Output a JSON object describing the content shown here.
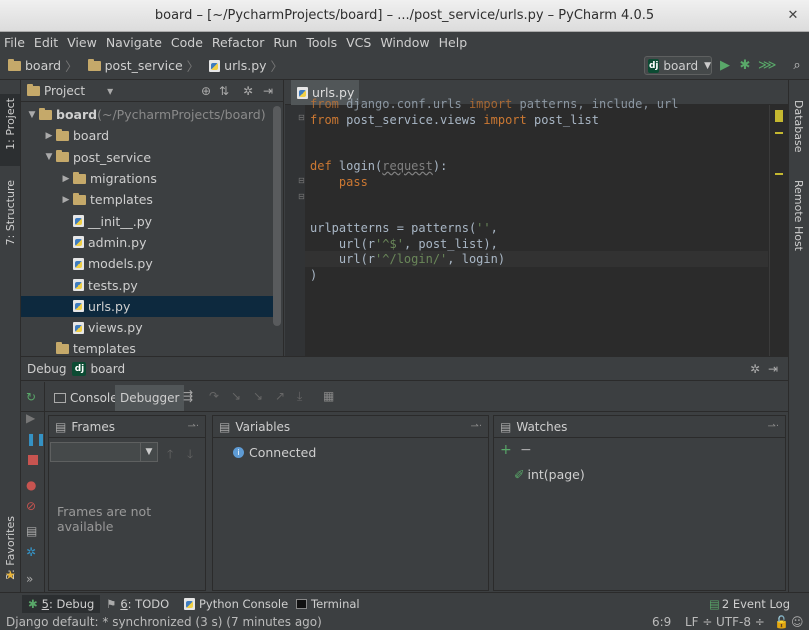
{
  "window": {
    "title": "board – [~/PycharmProjects/board] – .../post_service/urls.py – PyCharm 4.0.5",
    "close_glyph": "✕"
  },
  "menu": [
    "File",
    "Edit",
    "View",
    "Navigate",
    "Code",
    "Refactor",
    "Run",
    "Tools",
    "VCS",
    "Window",
    "Help"
  ],
  "breadcrumbs": [
    "board",
    "post_service",
    "urls.py"
  ],
  "run_config": {
    "label": "board",
    "dropdown": "▼"
  },
  "left_tools": {
    "project": "1: Project",
    "structure": "7: Structure",
    "favorites": "2: Favorites"
  },
  "right_tools": {
    "database": "Database",
    "remote": "Remote Host"
  },
  "project_panel": {
    "title": "Project",
    "dropdown": "▾",
    "tree": [
      {
        "name": "board",
        "suffix": " (~/PycharmProjects/board)",
        "indent": 0,
        "type": "folder",
        "arrow": "▼",
        "bold": true
      },
      {
        "name": "board",
        "indent": 1,
        "type": "folder",
        "arrow": "▶"
      },
      {
        "name": "post_service",
        "indent": 1,
        "type": "folder",
        "arrow": "▼"
      },
      {
        "name": "migrations",
        "indent": 2,
        "type": "folder",
        "arrow": "▶"
      },
      {
        "name": "templates",
        "indent": 2,
        "type": "folder",
        "arrow": "▶"
      },
      {
        "name": "__init__.py",
        "indent": 2,
        "type": "py"
      },
      {
        "name": "admin.py",
        "indent": 2,
        "type": "py"
      },
      {
        "name": "models.py",
        "indent": 2,
        "type": "py"
      },
      {
        "name": "tests.py",
        "indent": 2,
        "type": "py"
      },
      {
        "name": "urls.py",
        "indent": 2,
        "type": "py",
        "selected": true
      },
      {
        "name": "views.py",
        "indent": 2,
        "type": "py"
      },
      {
        "name": "templates",
        "indent": 1,
        "type": "folder"
      }
    ]
  },
  "editor": {
    "tab": "urls.py",
    "lines": [
      {
        "parts": [
          {
            "t": "from ",
            "c": "kw"
          },
          {
            "t": "django.conf.urls ",
            "c": ""
          },
          {
            "t": "import ",
            "c": "kw"
          },
          {
            "t": "patterns, include, url",
            "c": ""
          }
        ]
      },
      {
        "parts": [
          {
            "t": "from ",
            "c": "kw"
          },
          {
            "t": "post_service.views ",
            "c": ""
          },
          {
            "t": "import ",
            "c": "kw"
          },
          {
            "t": "post_list",
            "c": ""
          }
        ]
      },
      {
        "parts": []
      },
      {
        "parts": []
      },
      {
        "parts": [
          {
            "t": "def ",
            "c": "kw"
          },
          {
            "t": "login(",
            "c": ""
          },
          {
            "t": "request",
            "c": "param"
          },
          {
            "t": "):",
            "c": ""
          }
        ]
      },
      {
        "parts": [
          {
            "t": "    ",
            "c": ""
          },
          {
            "t": "pass",
            "c": "kw"
          }
        ]
      },
      {
        "parts": []
      },
      {
        "parts": []
      },
      {
        "parts": [
          {
            "t": "urlpatterns = patterns(",
            "c": ""
          },
          {
            "t": "''",
            "c": "str"
          },
          {
            "t": ",",
            "c": ""
          }
        ]
      },
      {
        "parts": [
          {
            "t": "    url(r",
            "c": ""
          },
          {
            "t": "'^$'",
            "c": "str"
          },
          {
            "t": ", post_list),",
            "c": ""
          }
        ]
      },
      {
        "parts": [
          {
            "t": "    url(r",
            "c": ""
          },
          {
            "t": "'^/login/'",
            "c": "str"
          },
          {
            "t": ", login)",
            "c": ""
          }
        ]
      },
      {
        "parts": [
          {
            "t": ")",
            "c": ""
          }
        ]
      }
    ]
  },
  "debug": {
    "label": "Debug",
    "config": "board",
    "tabs": {
      "console": "Console",
      "debugger": "Debugger"
    },
    "frames": {
      "title": "Frames",
      "empty": "Frames are not available"
    },
    "variables": {
      "title": "Variables",
      "status": "Connected"
    },
    "watches": {
      "title": "Watches",
      "item": "int(page)"
    }
  },
  "bottom_tabs": [
    {
      "num": "5",
      "label": ": Debug",
      "active": true
    },
    {
      "num": "6",
      "label": ": TODO"
    },
    {
      "num": "",
      "label": "Python Console"
    },
    {
      "num": "",
      "label": "Terminal"
    }
  ],
  "event_log": "2 Event Log",
  "status": {
    "message": "Django default: * synchronized (3 s) (7 minutes ago)",
    "position": "6:9",
    "line_sep": "LF ÷",
    "encoding": "UTF-8 ÷"
  }
}
